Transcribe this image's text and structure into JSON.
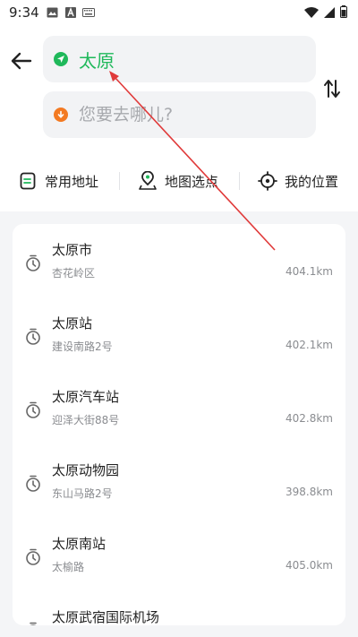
{
  "status_bar": {
    "time": "9:34",
    "left_icons": [
      "image-icon",
      "a-box-icon",
      "keyboard-icon"
    ],
    "right_icons": [
      "wifi-icon",
      "signal-icon",
      "battery-icon"
    ]
  },
  "route": {
    "origin": "太原",
    "destination_placeholder": "您要去哪儿?"
  },
  "quick_actions": {
    "common_address": "常用地址",
    "map_pick": "地图选点",
    "my_location": "我的位置"
  },
  "results": [
    {
      "name": "太原市",
      "address": "杏花岭区",
      "distance": "404.1km"
    },
    {
      "name": "太原站",
      "address": "建设南路2号",
      "distance": "402.1km"
    },
    {
      "name": "太原汽车站",
      "address": "迎泽大街88号",
      "distance": "402.8km"
    },
    {
      "name": "太原动物园",
      "address": "东山马路2号",
      "distance": "398.8km"
    },
    {
      "name": "太原南站",
      "address": "太榆路",
      "distance": "405.0km"
    },
    {
      "name": "太原武宿国际机场",
      "address": "",
      "distance": ""
    }
  ],
  "colors": {
    "origin_green": "#1fb85a",
    "dest_orange": "#f37a22",
    "annotation_red": "#e03a3a"
  }
}
